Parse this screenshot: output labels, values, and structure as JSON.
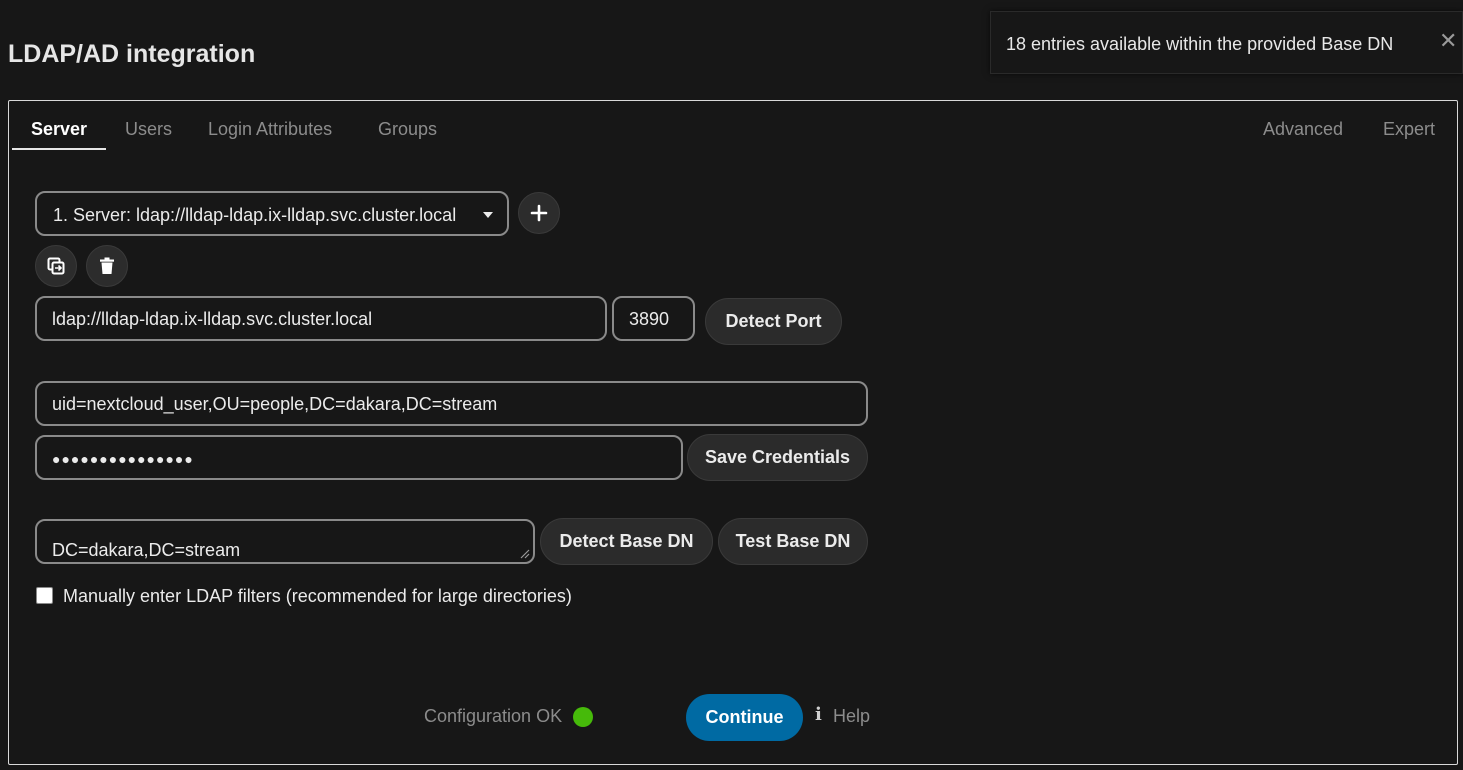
{
  "page": {
    "title": "LDAP/AD integration"
  },
  "toast": {
    "message": "18 entries available within the provided Base DN",
    "close_icon": "close-icon"
  },
  "tabs": {
    "server": "Server",
    "users": "Users",
    "login_attributes": "Login Attributes",
    "groups": "Groups",
    "advanced": "Advanced",
    "expert": "Expert"
  },
  "server_select": {
    "selected": "1. Server: ldap://lldap-ldap.ix-lldap.svc.cluster.local"
  },
  "icons": {
    "add": "plus-icon",
    "copy": "copy-config-icon",
    "delete": "trash-icon"
  },
  "host": {
    "value": "ldap://lldap-ldap.ix-lldap.svc.cluster.local"
  },
  "port": {
    "value": "3890"
  },
  "detect_port_label": "Detect Port",
  "user_dn": {
    "value": "uid=nextcloud_user,OU=people,DC=dakara,DC=stream"
  },
  "password": {
    "value": "●●●●●●●●●●●●●●●"
  },
  "save_credentials_label": "Save Credentials",
  "base_dn": {
    "value": "DC=dakara,DC=stream"
  },
  "detect_base_dn_label": "Detect Base DN",
  "test_base_dn_label": "Test Base DN",
  "manual_filters": {
    "label": "Manually enter LDAP filters (recommended for large directories)",
    "checked": false
  },
  "status": {
    "text": "Configuration OK",
    "color": "#46ba0a"
  },
  "continue_label": "Continue",
  "help": {
    "icon": "i",
    "label": "Help"
  },
  "colors": {
    "accent": "#006aa3",
    "background": "#171717"
  }
}
